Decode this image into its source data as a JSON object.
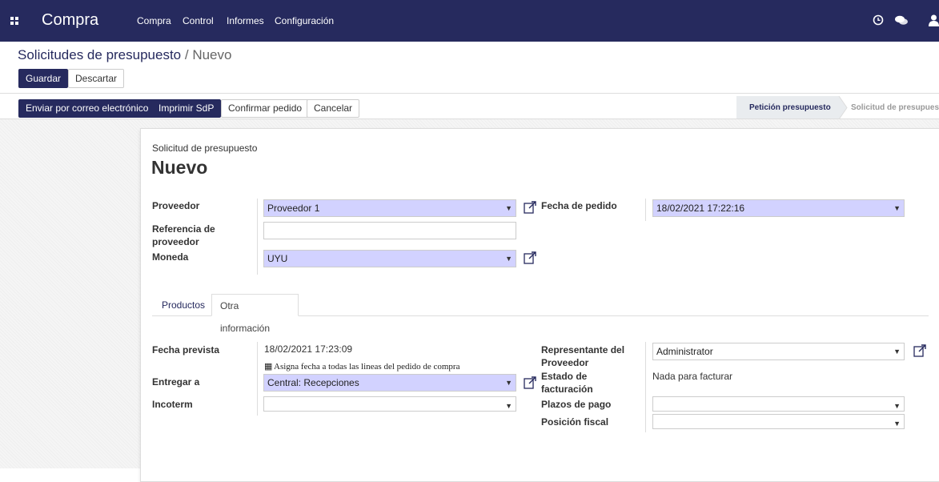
{
  "navbar": {
    "brand": "Compra",
    "menu": [
      "Compra",
      "Control",
      "Informes",
      "Configuración"
    ],
    "icons": [
      "clock-icon",
      "chat-icon",
      "user-icon"
    ]
  },
  "breadcrumb": {
    "parent": "Solicitudes de presupuesto",
    "separator": " / ",
    "current": "Nuevo"
  },
  "actions": {
    "save": "Guardar",
    "discard": "Descartar"
  },
  "header_buttons": {
    "send_email": "Enviar por correo electrónico",
    "print": "Imprimir SdP",
    "confirm": "Confirmar pedido",
    "cancel": "Cancelar"
  },
  "status_stages": {
    "active": "Petición presupuesto",
    "next": "Solicitud de presupuesto"
  },
  "form": {
    "subtitle": "Solicitud de presupuesto",
    "title": "Nuevo",
    "proveedor_label": "Proveedor",
    "proveedor_value": "Proveedor 1",
    "referencia_label_1": "Referencia de",
    "referencia_label_2": "proveedor",
    "moneda_label": "Moneda",
    "moneda_value": "UYU",
    "fecha_pedido_label": "Fecha de pedido",
    "fecha_pedido_value": "18/02/2021 17:22:16"
  },
  "tabs": {
    "products": "Productos",
    "other": "Otra información"
  },
  "other_info": {
    "fecha_prevista_label": "Fecha prevista",
    "fecha_prevista_value": "18/02/2021 17:23:09",
    "asigna_note": "Asigna fecha a todas las lineas del pedido de compra",
    "entregar_label": "Entregar a",
    "entregar_value": "Central: Recepciones",
    "incoterm_label": "Incoterm",
    "incoterm_value": "",
    "representante_label_1": "Representante del",
    "representante_label_2": "Proveedor",
    "representante_value": "Administrator",
    "estado_label_1": "Estado de",
    "estado_label_2": "facturación",
    "estado_value": "Nada para facturar",
    "plazos_label": "Plazos de pago",
    "plazos_value": "",
    "posicion_label": "Posición fiscal",
    "posicion_value": ""
  },
  "colors": {
    "navbar": "#262a5e",
    "required_field": "#d2d2ff"
  }
}
